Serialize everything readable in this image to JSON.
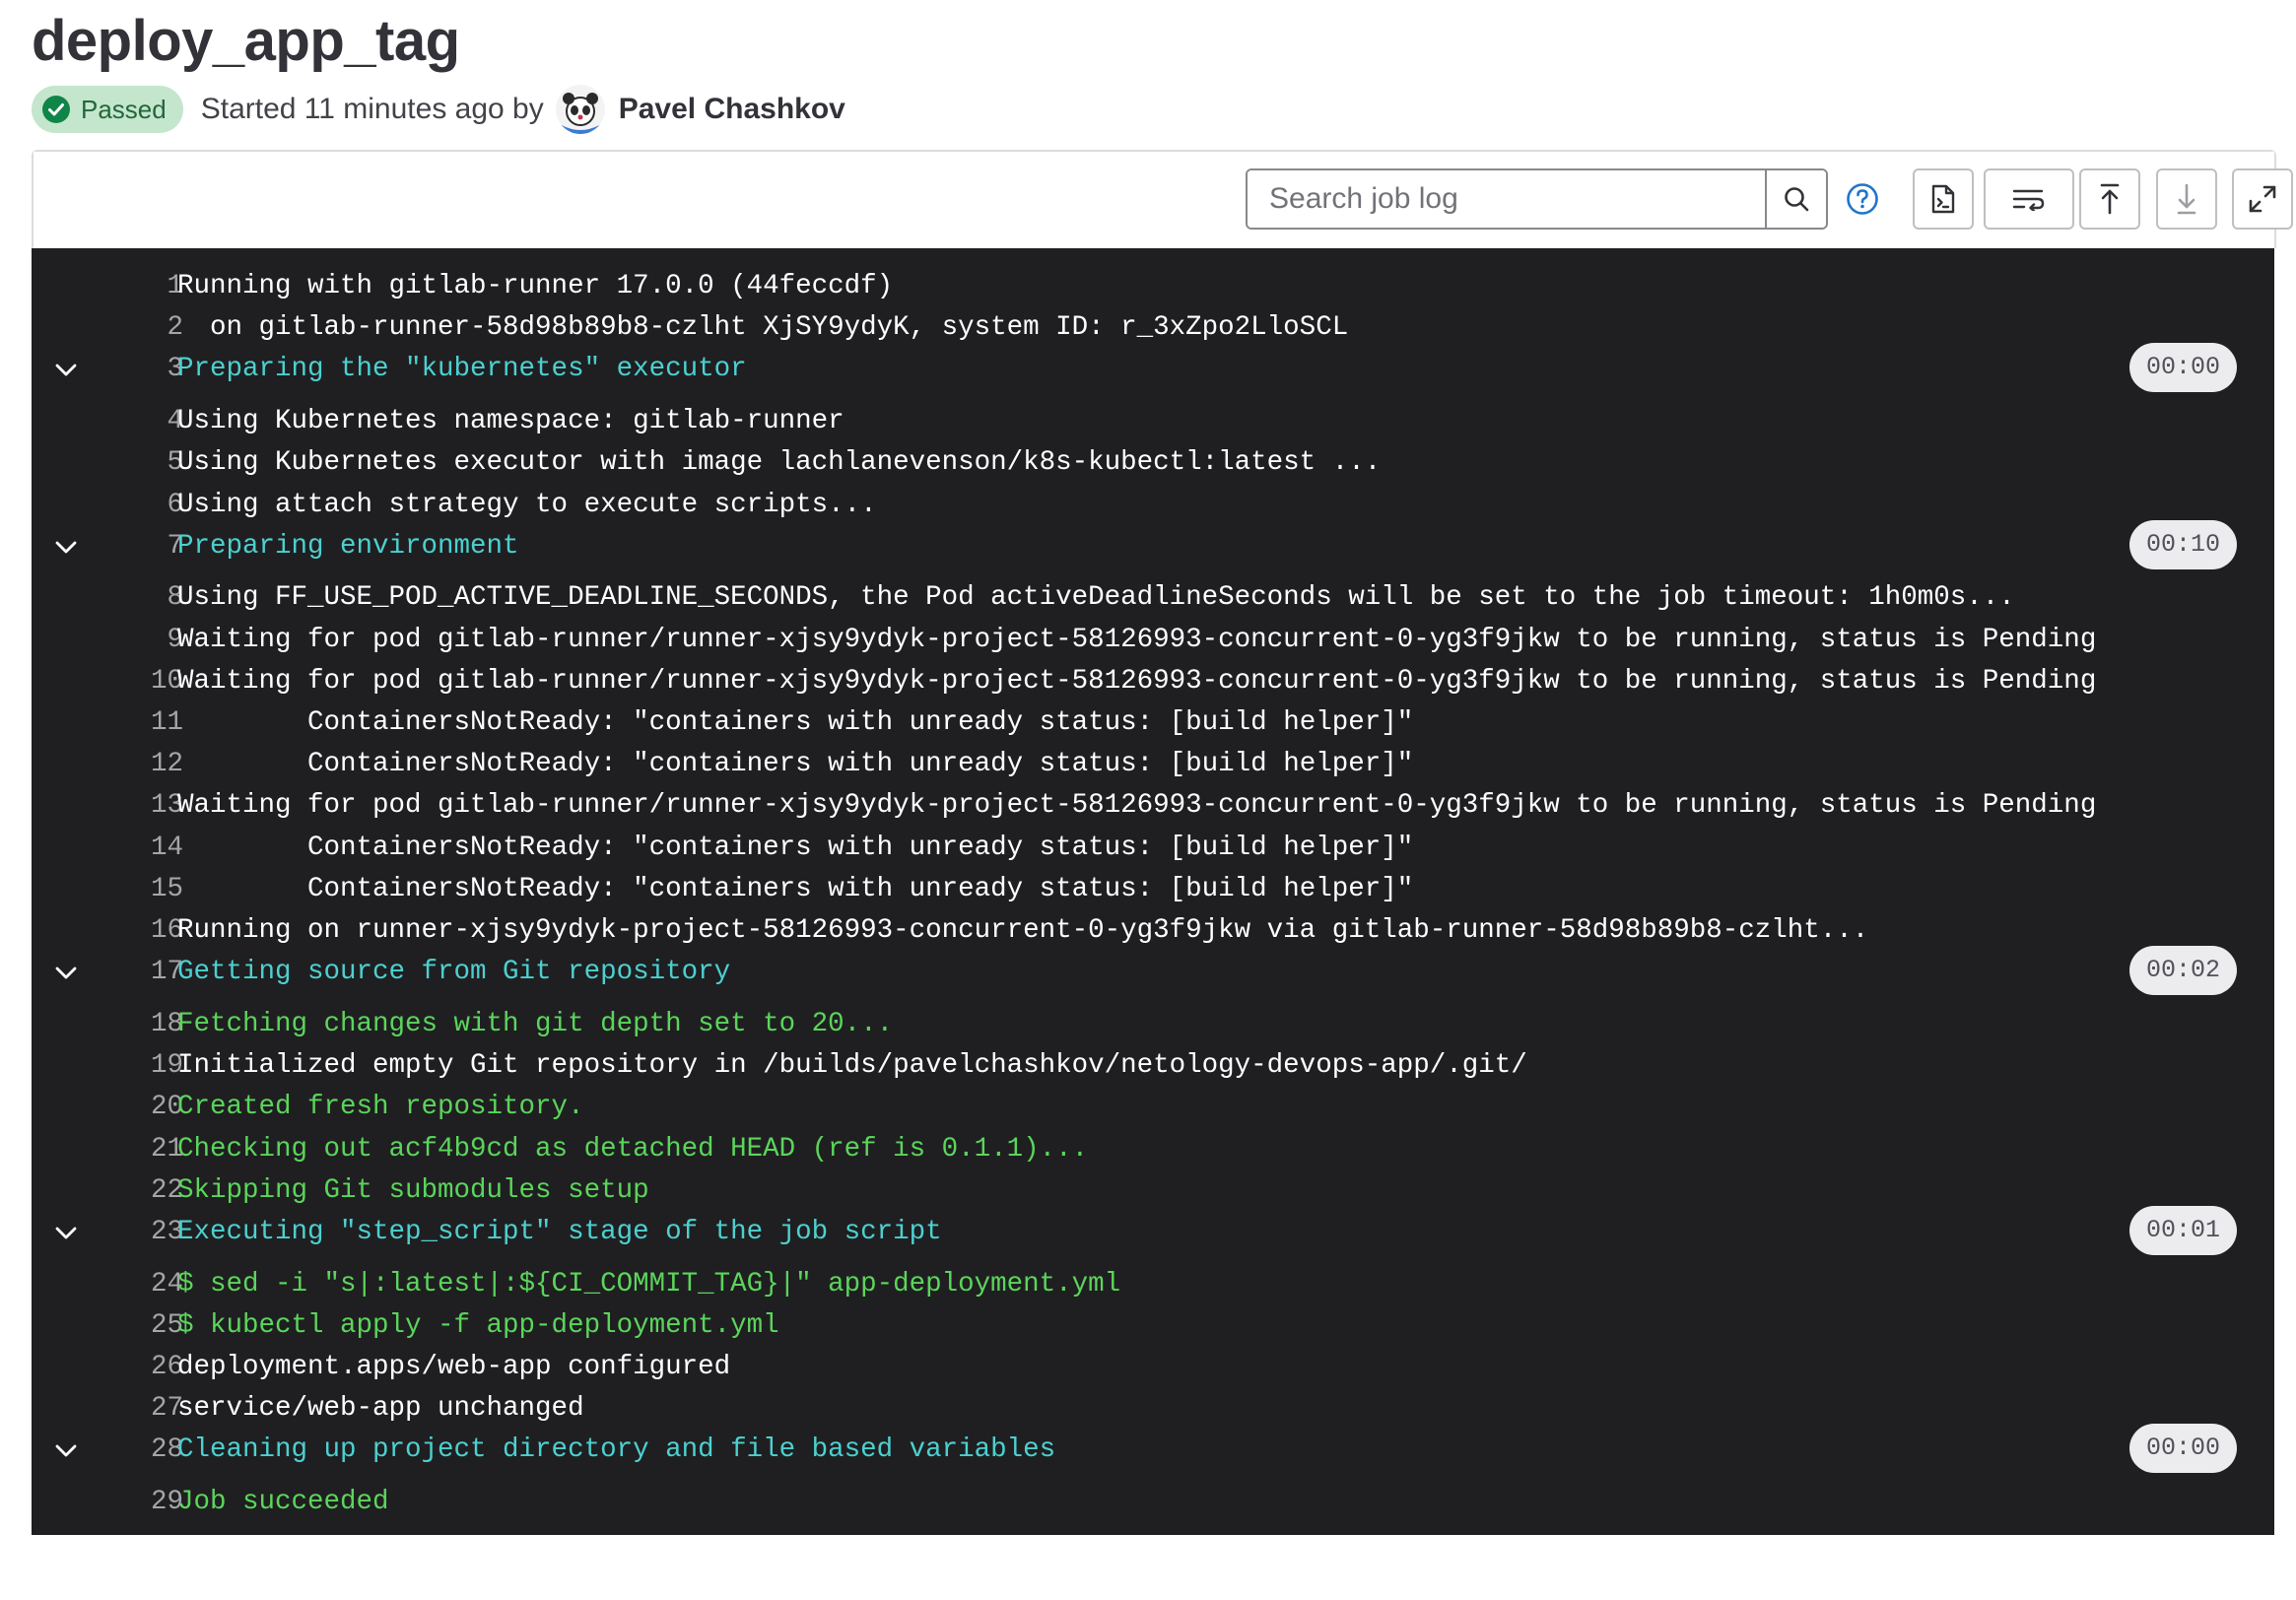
{
  "job": {
    "title": "deploy_app_tag",
    "status": "Passed",
    "started_text": "Started 11 minutes ago by",
    "author": "Pavel Chashkov"
  },
  "toolbar": {
    "search_placeholder": "Search job log",
    "icons": [
      "search-icon",
      "help-icon",
      "raw-log-icon",
      "wrap-text-icon",
      "scroll-top-icon",
      "scroll-bottom-icon",
      "fullscreen-icon"
    ]
  },
  "colors": {
    "status_bg": "#c3e6cd",
    "status_text": "#24663b",
    "log_bg": "#1f1f21",
    "section_header": "#4dd0d0",
    "success_text": "#5bd55b"
  },
  "log": [
    {
      "n": "1",
      "text": "Running with gitlab-runner 17.0.0 (44feccdf)",
      "kind": "normal"
    },
    {
      "n": "2",
      "text": "  on gitlab-runner-58d98b89b8-czlht XjSY9ydyK, system ID: r_3xZpo2LloSCL",
      "kind": "normal"
    },
    {
      "n": "3",
      "text": "Preparing the \"kubernetes\" executor",
      "kind": "section",
      "duration": "00:00"
    },
    {
      "n": "4",
      "text": "Using Kubernetes namespace: gitlab-runner",
      "kind": "normal"
    },
    {
      "n": "5",
      "text": "Using Kubernetes executor with image lachlanevenson/k8s-kubectl:latest ...",
      "kind": "normal"
    },
    {
      "n": "6",
      "text": "Using attach strategy to execute scripts...",
      "kind": "normal"
    },
    {
      "n": "7",
      "text": "Preparing environment",
      "kind": "section",
      "duration": "00:10"
    },
    {
      "n": "8",
      "text": "Using FF_USE_POD_ACTIVE_DEADLINE_SECONDS, the Pod activeDeadlineSeconds will be set to the job timeout: 1h0m0s...",
      "kind": "normal"
    },
    {
      "n": "9",
      "text": "Waiting for pod gitlab-runner/runner-xjsy9ydyk-project-58126993-concurrent-0-yg3f9jkw to be running, status is Pending",
      "kind": "normal"
    },
    {
      "n": "10",
      "text": "Waiting for pod gitlab-runner/runner-xjsy9ydyk-project-58126993-concurrent-0-yg3f9jkw to be running, status is Pending",
      "kind": "normal"
    },
    {
      "n": "11",
      "text": "\tContainersNotReady: \"containers with unready status: [build helper]\"",
      "kind": "normal"
    },
    {
      "n": "12",
      "text": "\tContainersNotReady: \"containers with unready status: [build helper]\"",
      "kind": "normal"
    },
    {
      "n": "13",
      "text": "Waiting for pod gitlab-runner/runner-xjsy9ydyk-project-58126993-concurrent-0-yg3f9jkw to be running, status is Pending",
      "kind": "normal"
    },
    {
      "n": "14",
      "text": "\tContainersNotReady: \"containers with unready status: [build helper]\"",
      "kind": "normal"
    },
    {
      "n": "15",
      "text": "\tContainersNotReady: \"containers with unready status: [build helper]\"",
      "kind": "normal"
    },
    {
      "n": "16",
      "text": "Running on runner-xjsy9ydyk-project-58126993-concurrent-0-yg3f9jkw via gitlab-runner-58d98b89b8-czlht...",
      "kind": "normal"
    },
    {
      "n": "17",
      "text": "Getting source from Git repository",
      "kind": "section",
      "duration": "00:02"
    },
    {
      "n": "18",
      "text": "Fetching changes with git depth set to 20...",
      "kind": "green"
    },
    {
      "n": "19",
      "text": "Initialized empty Git repository in /builds/pavelchashkov/netology-devops-app/.git/",
      "kind": "normal"
    },
    {
      "n": "20",
      "text": "Created fresh repository.",
      "kind": "green"
    },
    {
      "n": "21",
      "text": "Checking out acf4b9cd as detached HEAD (ref is 0.1.1)...",
      "kind": "green"
    },
    {
      "n": "22",
      "text": "Skipping Git submodules setup",
      "kind": "green"
    },
    {
      "n": "23",
      "text": "Executing \"step_script\" stage of the job script",
      "kind": "section",
      "duration": "00:01"
    },
    {
      "n": "24",
      "text": "$ sed -i \"s|:latest|:${CI_COMMIT_TAG}|\" app-deployment.yml",
      "kind": "green"
    },
    {
      "n": "25",
      "text": "$ kubectl apply -f app-deployment.yml",
      "kind": "green"
    },
    {
      "n": "26",
      "text": "deployment.apps/web-app configured",
      "kind": "normal"
    },
    {
      "n": "27",
      "text": "service/web-app unchanged",
      "kind": "normal"
    },
    {
      "n": "28",
      "text": "Cleaning up project directory and file based variables",
      "kind": "section",
      "duration": "00:00"
    },
    {
      "n": "29",
      "text": "Job succeeded",
      "kind": "green"
    }
  ]
}
